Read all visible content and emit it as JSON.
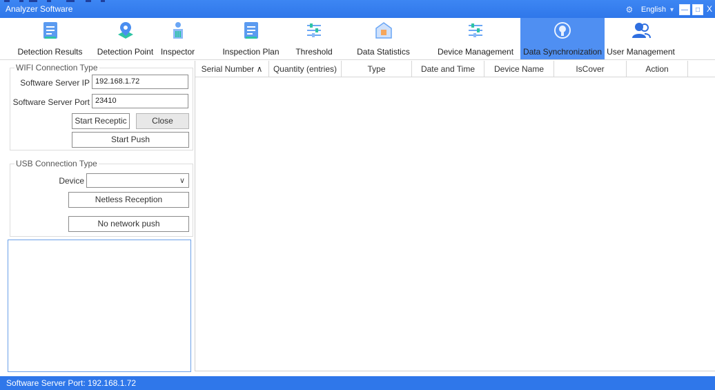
{
  "window": {
    "title": "Analyzer Software",
    "language": "English",
    "settings_icon": "gear-icon",
    "minimize_label": "—",
    "maximize_label": "□",
    "close_label": "X",
    "accent_color": "#2f77ea"
  },
  "toolbar": {
    "active": "Data Synchronization",
    "items": [
      {
        "label": "Detection Results",
        "icon": "document-icon"
      },
      {
        "label": "Detection Point",
        "icon": "map-pin-icon"
      },
      {
        "label": "Inspector",
        "icon": "inspector-icon"
      },
      {
        "label": "Inspection Plan",
        "icon": "document-icon"
      },
      {
        "label": "Threshold",
        "icon": "sliders-icon"
      },
      {
        "label": "Data Statistics",
        "icon": "home-icon"
      },
      {
        "label": "Device Management",
        "icon": "sliders-icon"
      },
      {
        "label": "Data Synchronization",
        "icon": "sync-icon"
      },
      {
        "label": "User Management",
        "icon": "users-icon"
      }
    ]
  },
  "wifi": {
    "legend": "WIFI Connection Type",
    "ip_label": "Software Server IP",
    "ip_value": "192.168.1.72",
    "port_label": "Software Server Port",
    "port_value": "23410",
    "start_reception": "Start Receptic",
    "close_receive": "Close Receive",
    "start_push": "Start Push"
  },
  "usb": {
    "legend": "USB Connection Type",
    "device_label": "Device",
    "device_value": "",
    "netless_reception": "Netless Reception",
    "no_network_push": "No network push"
  },
  "table": {
    "columns": [
      "Serial Number ^",
      "Quantity (entries)",
      "Type",
      "Date and Time",
      "Device Name",
      "IsCover",
      "Action"
    ],
    "rows": []
  },
  "status": {
    "text": "Software Server Port: 192.168.1.72"
  }
}
